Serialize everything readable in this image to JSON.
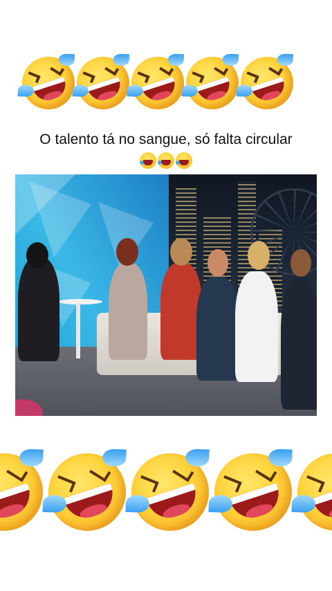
{
  "caption": {
    "text": "O talento tá no sangue, só falta circular"
  },
  "emoji_rows": {
    "top_count": 5,
    "bottom_count": 5,
    "icon": "rolling-on-the-floor-laughing-icon",
    "caption_icon": "grinning-squinting-face-icon",
    "caption_icon_count": 3
  },
  "video": {
    "description_icon": "video-still-image"
  },
  "colors": {
    "background": "#ffffff",
    "text": "#111111",
    "emoji_yellow": "#ffd23a",
    "tear_blue": "#3aa0ef"
  }
}
